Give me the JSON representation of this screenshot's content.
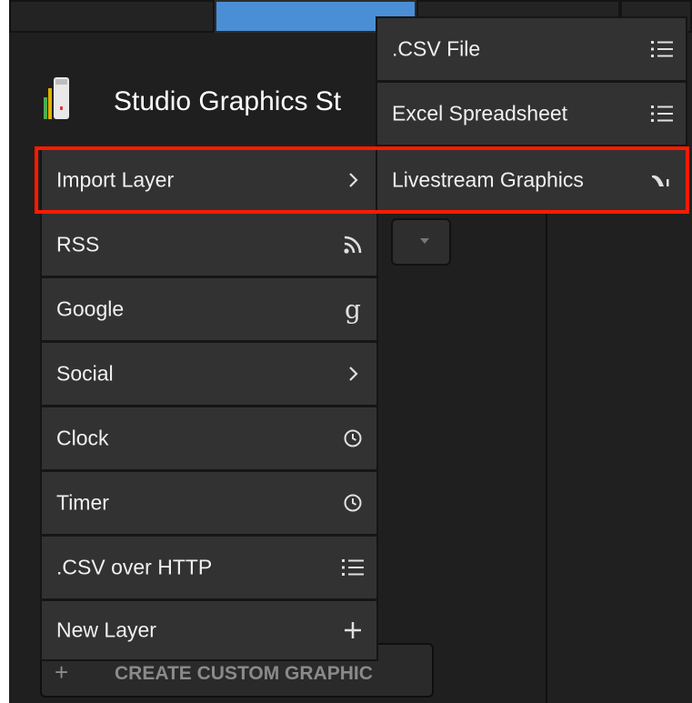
{
  "app": {
    "title": "Studio Graphics St"
  },
  "main_menu": {
    "items": [
      {
        "label": "Import Layer",
        "icon": "chevron-right-icon"
      },
      {
        "label": "RSS",
        "icon": "rss-icon"
      },
      {
        "label": "Google",
        "icon": "google-icon"
      },
      {
        "label": "Social",
        "icon": "chevron-right-icon"
      },
      {
        "label": "Clock",
        "icon": "clock-icon"
      },
      {
        "label": "Timer",
        "icon": "clock-icon"
      },
      {
        "label": ".CSV over HTTP",
        "icon": "list-icon"
      },
      {
        "label": "New Layer",
        "icon": "plus-icon"
      }
    ]
  },
  "sub_menu": {
    "items": [
      {
        "label": ".CSV File",
        "icon": "list-icon"
      },
      {
        "label": "Excel Spreadsheet",
        "icon": "list-icon"
      },
      {
        "label": "Livestream Graphics",
        "icon": "livestream-icon"
      }
    ]
  },
  "footer": {
    "create_button_label": "CREATE CUSTOM GRAPHIC",
    "create_button_icon": "plus-icon"
  },
  "colors": {
    "highlight": "#ff1a00",
    "tab_active": "#4a8fd6",
    "menu_bg": "#323232"
  }
}
